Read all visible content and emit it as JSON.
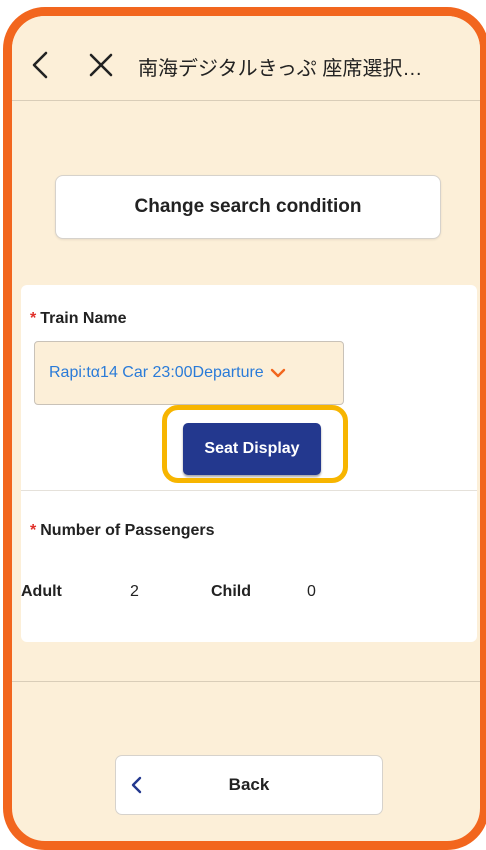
{
  "header": {
    "title": "南海デジタルきっぷ  座席選択…"
  },
  "change_button": {
    "label": "Change search condition"
  },
  "train": {
    "required_mark": "*",
    "section_label": "Train Name",
    "selected_value": "Rapi:tα14 Car   23:00Departure"
  },
  "seat_display_button": {
    "label": "Seat Display"
  },
  "passengers": {
    "required_mark": "*",
    "section_label": "Number of Passengers",
    "adult_label": "Adult",
    "adult_count": "2",
    "child_label": "Child",
    "child_count": "0"
  },
  "back_button": {
    "label": "Back"
  },
  "colors": {
    "frame_accent": "#f2661e",
    "background": "#fcefd8",
    "primary_button": "#23388e",
    "highlight": "#f7b500",
    "link_text": "#2a7bd8",
    "required": "#e0302a"
  }
}
